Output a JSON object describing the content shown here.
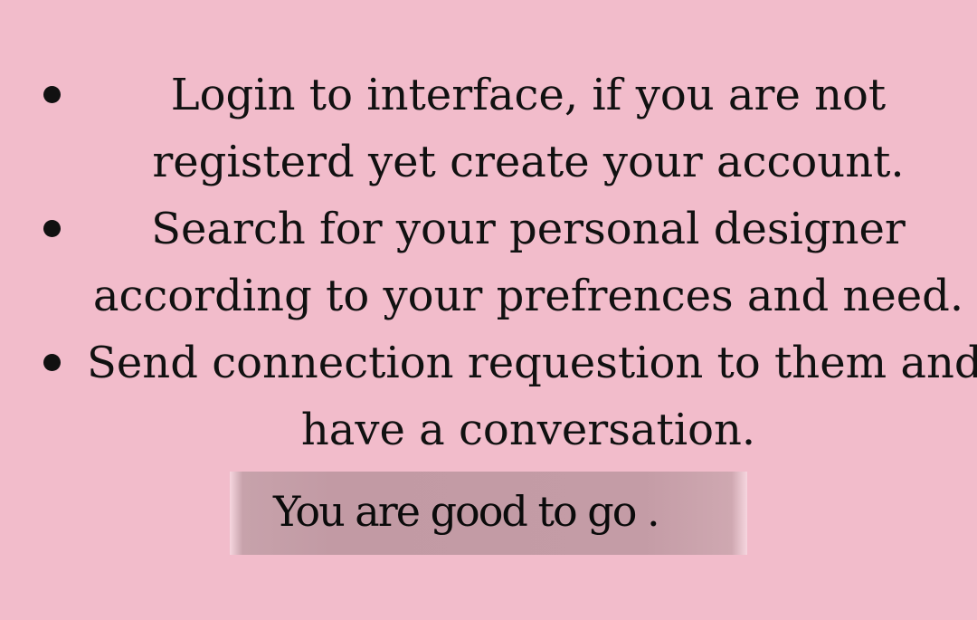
{
  "steps": [
    {
      "bullet_icon": "bullet-dot-icon",
      "lines": [
        "Login to interface, if you are not",
        "registerd yet create your account."
      ]
    },
    {
      "bullet_icon": "bullet-dot-icon",
      "lines": [
        "Search for your personal designer",
        "according to your prefrences and need."
      ]
    },
    {
      "bullet_icon": "bullet-dot-icon",
      "lines": [
        "Send connection requestion to them and",
        "have a conversation."
      ]
    }
  ],
  "cta": {
    "label": "You are good to go ."
  },
  "colors": {
    "background": "#f2bccb",
    "text": "#111111",
    "button": "#c29aa4"
  }
}
